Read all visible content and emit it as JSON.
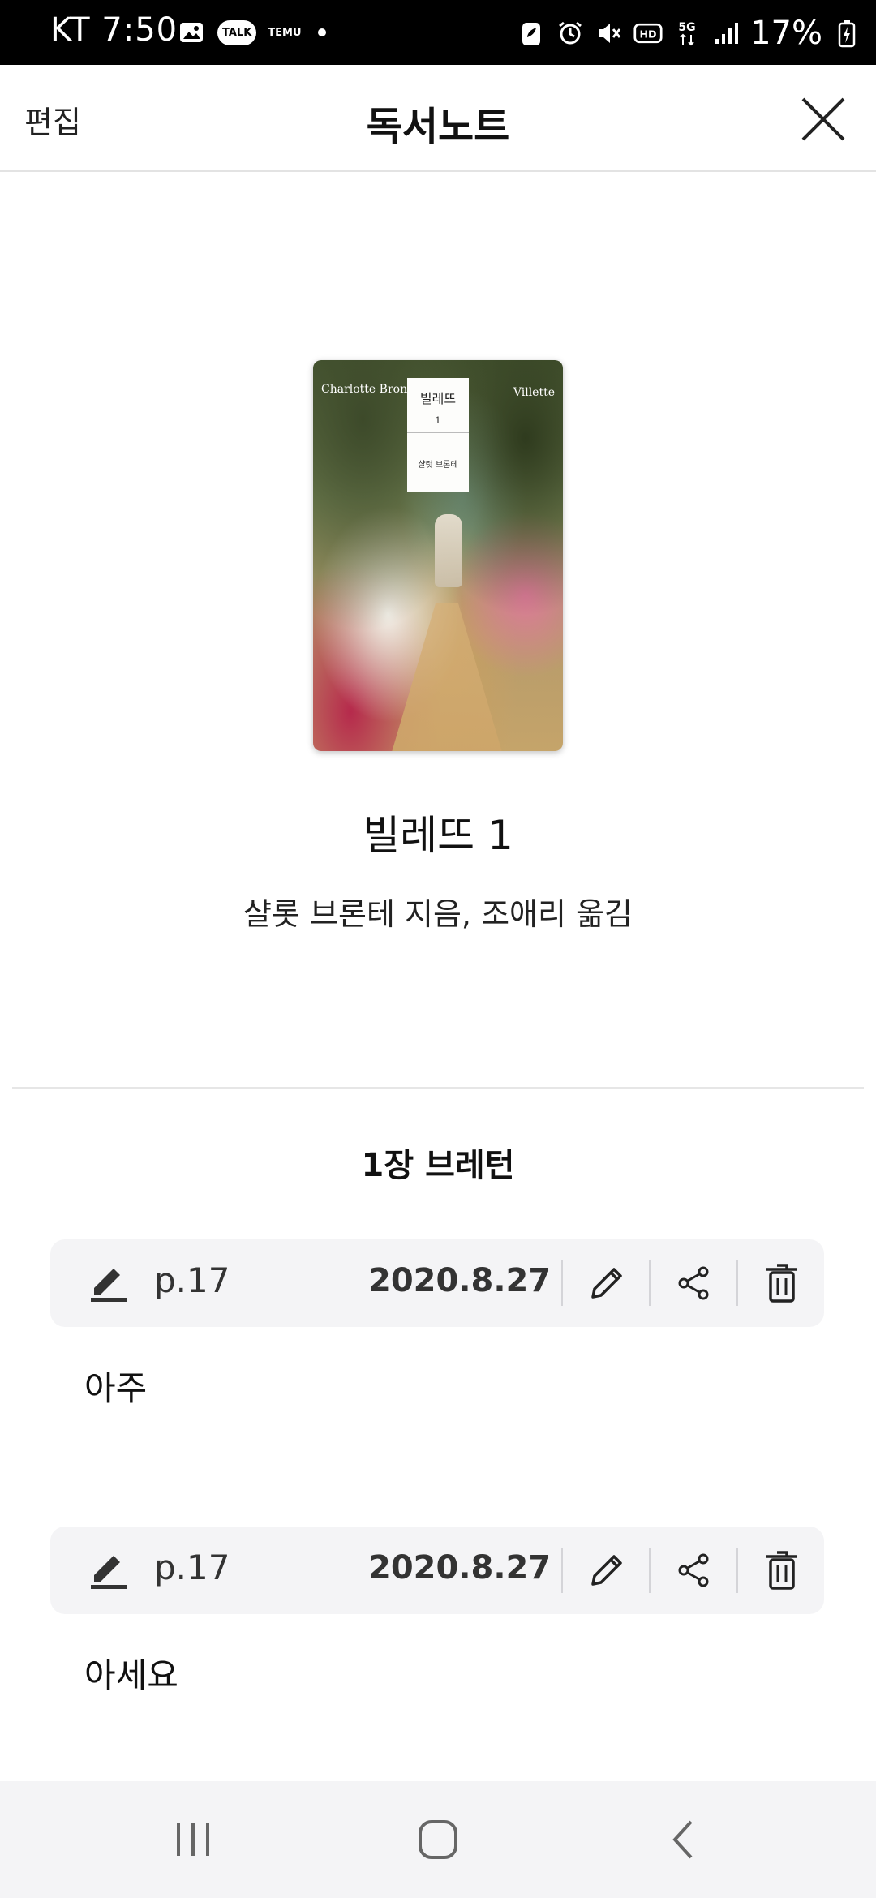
{
  "status_bar": {
    "carrier_time": "KT 7:50",
    "talk_badge": "TALK",
    "temu_badge": "TEMU",
    "battery_percent": "17%"
  },
  "header": {
    "edit_label": "편집",
    "title": "독서노트"
  },
  "book": {
    "cover": {
      "author_en": "Charlotte Brontë",
      "title_en": "Villette",
      "title_ko": "빌레뜨",
      "volume": "1",
      "author_ko": "샬럿 브론테"
    },
    "title": "빌레뜨 1",
    "author_line": "샬롯 브론테 지음, 조애리 옮김"
  },
  "chapter": {
    "title": "1장 브레턴"
  },
  "notes": [
    {
      "page": "p.17",
      "date": "2020.8.27",
      "text": "아주"
    },
    {
      "page": "p.17",
      "date": "2020.8.27",
      "text": "아세요"
    }
  ],
  "icons": {
    "edit_note": "pencil-icon",
    "share": "share-icon",
    "delete": "trash-icon",
    "close": "close-icon"
  }
}
